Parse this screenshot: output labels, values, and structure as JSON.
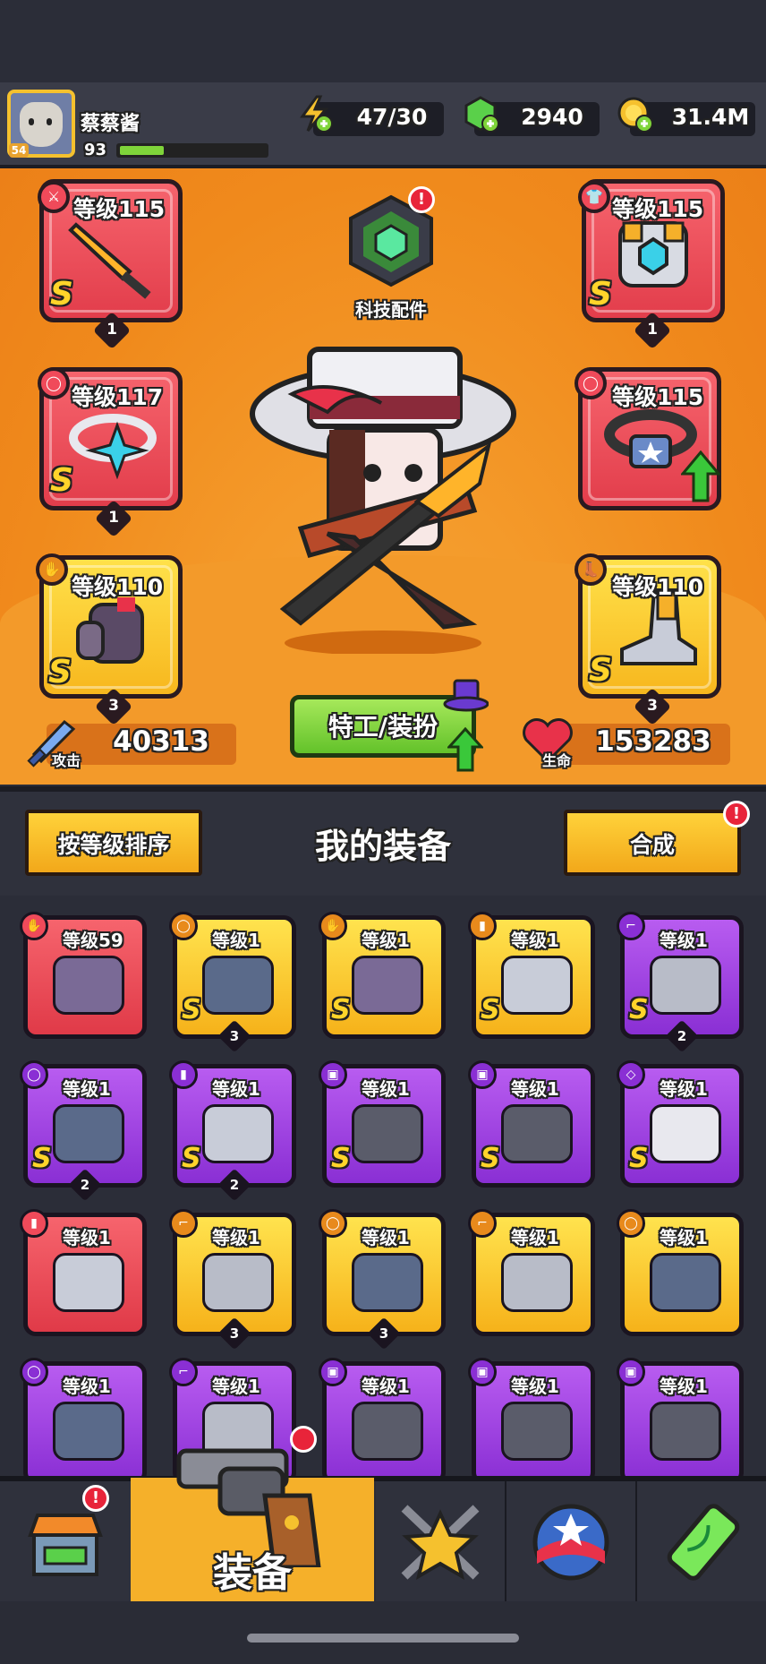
{
  "player": {
    "name": "蔡蔡酱",
    "level_badge": "54",
    "xp_level": "93",
    "xp_progress": 0.3
  },
  "resources": {
    "energy": "47/30",
    "gems": "2940",
    "coins": "31.4M"
  },
  "tech_part": {
    "label": "科技配件",
    "alert": "!"
  },
  "equipped": {
    "weapon": {
      "level": "等级115",
      "grade": "S",
      "stars": "1"
    },
    "armor": {
      "level": "等级115",
      "grade": "S",
      "stars": "1"
    },
    "ring": {
      "level": "等级117",
      "grade": "S",
      "stars": "1"
    },
    "belt": {
      "level": "等级115",
      "grade": "S"
    },
    "glove": {
      "level": "等级110",
      "grade": "S",
      "stars": "3"
    },
    "boots": {
      "level": "等级110",
      "grade": "S",
      "stars": "3"
    }
  },
  "agent_button": "特工/装扮",
  "stats": {
    "attack_label": "攻击",
    "attack_value": "40313",
    "hp_label": "生命",
    "hp_value": "153283"
  },
  "equip_header": {
    "sort_button": "按等级排序",
    "title": "我的装备",
    "merge_button": "合成",
    "merge_alert": "!"
  },
  "inventory": [
    {
      "level": "等级59",
      "rarity": "red",
      "type": "glove",
      "grade": "",
      "stars": ""
    },
    {
      "level": "等级1",
      "rarity": "yellow",
      "type": "belt",
      "grade": "S",
      "stars": "3"
    },
    {
      "level": "等级1",
      "rarity": "yellow",
      "type": "glove",
      "grade": "S",
      "stars": ""
    },
    {
      "level": "等级1",
      "rarity": "yellow",
      "type": "boots",
      "grade": "S",
      "stars": ""
    },
    {
      "level": "等级1",
      "rarity": "purple",
      "type": "weapon",
      "grade": "S",
      "stars": "2"
    },
    {
      "level": "等级1",
      "rarity": "purple",
      "type": "belt",
      "grade": "S",
      "stars": "2"
    },
    {
      "level": "等级1",
      "rarity": "purple",
      "type": "boots",
      "grade": "S",
      "stars": "2"
    },
    {
      "level": "等级1",
      "rarity": "purple",
      "type": "armor",
      "grade": "S",
      "stars": ""
    },
    {
      "level": "等级1",
      "rarity": "purple",
      "type": "armor",
      "grade": "S",
      "stars": ""
    },
    {
      "level": "等级1",
      "rarity": "purple",
      "type": "ring",
      "grade": "S",
      "stars": ""
    },
    {
      "level": "等级1",
      "rarity": "red",
      "type": "boots",
      "grade": "",
      "stars": ""
    },
    {
      "level": "等级1",
      "rarity": "yellow",
      "type": "weapon",
      "grade": "",
      "stars": "3"
    },
    {
      "level": "等级1",
      "rarity": "yellow",
      "type": "belt",
      "grade": "",
      "stars": "3"
    },
    {
      "level": "等级1",
      "rarity": "yellow",
      "type": "weapon",
      "grade": "",
      "stars": ""
    },
    {
      "level": "等级1",
      "rarity": "yellow",
      "type": "belt",
      "grade": "",
      "stars": ""
    },
    {
      "level": "等级1",
      "rarity": "purple",
      "type": "belt",
      "grade": "",
      "stars": ""
    },
    {
      "level": "等级1",
      "rarity": "purple",
      "type": "weapon",
      "grade": "",
      "stars": ""
    },
    {
      "level": "等级1",
      "rarity": "purple",
      "type": "armor",
      "grade": "",
      "stars": ""
    },
    {
      "level": "等级1",
      "rarity": "purple",
      "type": "armor",
      "grade": "",
      "stars": ""
    },
    {
      "level": "等级1",
      "rarity": "purple",
      "type": "armor",
      "grade": "",
      "stars": ""
    }
  ],
  "nav": {
    "equip_label": "装备",
    "shop_alert": "!"
  },
  "colors": {
    "red": "#e23d4b",
    "yellow": "#f7b71e",
    "purple": "#8a2fd4",
    "orange_bg": "#f08a1c",
    "nav_active": "#f5b02a"
  }
}
